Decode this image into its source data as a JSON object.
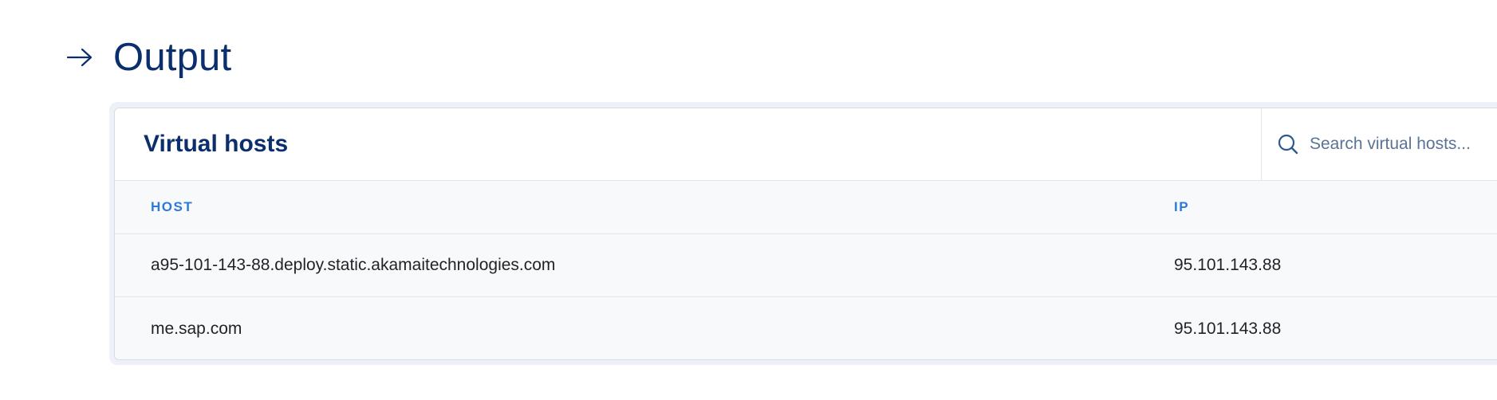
{
  "section": {
    "title": "Output",
    "icon": "arrow-right-icon"
  },
  "card": {
    "title": "Virtual hosts",
    "search": {
      "placeholder": "Search virtual hosts...",
      "value": "",
      "icon": "search-icon"
    },
    "columns": [
      "HOST",
      "IP"
    ],
    "rows": [
      {
        "host": "a95-101-143-88.deploy.static.akamaitechnologies.com",
        "ip": "95.101.143.88"
      },
      {
        "host": "me.sap.com",
        "ip": "95.101.143.88"
      }
    ]
  },
  "colors": {
    "title": "#0b2e6d",
    "column_header": "#2d7ad6",
    "row_background": "#f8f9fa",
    "border": "#e2e6ec"
  }
}
